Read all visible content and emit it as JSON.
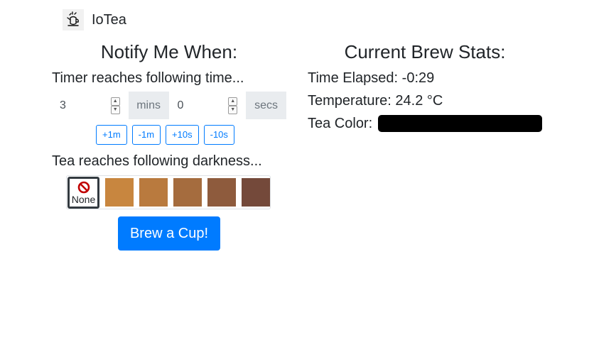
{
  "app": {
    "brand": "IoTea"
  },
  "notify": {
    "heading": "Notify Me When:",
    "timer_label": "Timer reaches following time...",
    "minutes_value": "3",
    "minutes_unit": "mins",
    "seconds_value": "0",
    "seconds_unit": "secs",
    "buttons": {
      "plus_1m": "+1m",
      "minus_1m": "-1m",
      "plus_10s": "+10s",
      "minus_10s": "-10s"
    },
    "darkness_label": "Tea reaches following darkness...",
    "darkness_options": {
      "none_label": "None",
      "selected": "None",
      "colors": [
        "#c8863f",
        "#b97a3e",
        "#a56c3e",
        "#8e5b3d",
        "#74493a"
      ]
    },
    "brew_button": "Brew a Cup!"
  },
  "stats": {
    "heading": "Current Brew Stats:",
    "time_elapsed_label": "Time Elapsed:",
    "time_elapsed_value": "-0:29",
    "temperature_label": "Temperature:",
    "temperature_value": "24.2 °C",
    "tea_color_label": "Tea Color:",
    "tea_color_value": "#000000"
  },
  "colors": {
    "accent": "#007bff"
  }
}
